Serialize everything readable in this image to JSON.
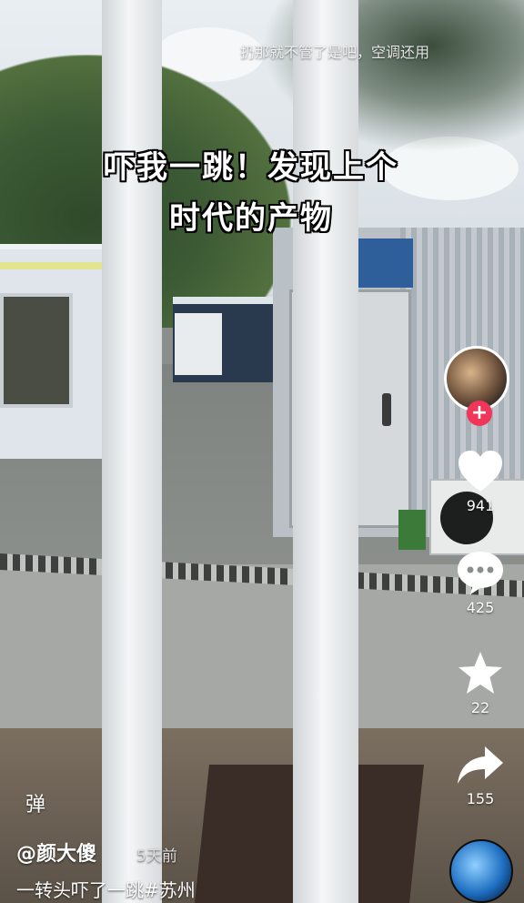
{
  "overlay": {
    "top_scroll_text": "扔那就不管了是吧，空调还用",
    "caption_line1": "吓我一跳！发现上个",
    "caption_line2": "时代的产物"
  },
  "rail": {
    "follow_glyph": "+",
    "likes": "941",
    "comments": "425",
    "favorites": "22",
    "shares": "155"
  },
  "bottom": {
    "danmaku_label": "弹",
    "author": "@颜大傻",
    "posted": "5天前",
    "description": "一转头吓了一跳#苏州"
  },
  "icons": {
    "like": "heart-icon",
    "comment": "comment-icon",
    "favorite": "star-icon",
    "share": "share-arrow-icon",
    "music": "music-disc-icon"
  }
}
